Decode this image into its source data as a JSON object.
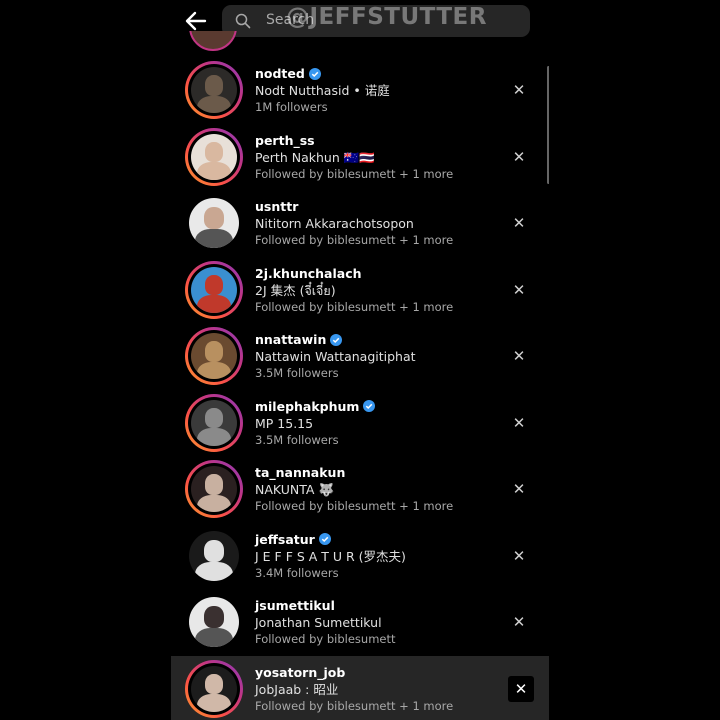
{
  "header": {
    "back_icon": "arrow-left-icon",
    "search_icon": "magnifier-icon",
    "search_placeholder": "Search",
    "watermark": "@JEFFSTUTTER"
  },
  "colors": {
    "background": "#000000",
    "search_bg": "#262626",
    "verified": "#3897f0",
    "secondary_text": "#a8a8a8",
    "story_ring": [
      "#f9a12e",
      "#fc5245",
      "#c13584",
      "#8a3ab9"
    ]
  },
  "accounts": [
    {
      "username": "nodted",
      "verified": true,
      "name": "Nodt Nutthasid • 诺庭",
      "meta": "1M followers",
      "ring": true,
      "photo": [
        "#6b5a4a",
        "#2c2a28"
      ]
    },
    {
      "username": "perth_ss",
      "verified": false,
      "name": "Perth Nakhun 🇦🇺🇹🇭",
      "meta": "Followed by biblesumett + 1 more",
      "ring": true,
      "photo": [
        "#d9b8a0",
        "#e8e0d8"
      ]
    },
    {
      "username": "usnttr",
      "verified": false,
      "name": "Nititorn Akkarachotsopon",
      "meta": "Followed by biblesumett + 1 more",
      "ring": false,
      "photo": [
        "#c9a792",
        "#e9e9e9"
      ]
    },
    {
      "username": "2j.khunchalach",
      "verified": false,
      "name": "2J 集杰 (จี๋เจี๋ย)",
      "meta": "Followed by biblesumett + 1 more",
      "ring": true,
      "photo": [
        "#c0392b",
        "#3a8fd0"
      ]
    },
    {
      "username": "nnattawin",
      "verified": true,
      "name": "Nattawin Wattanagitiphat",
      "meta": "3.5M followers",
      "ring": true,
      "photo": [
        "#b89060",
        "#6a4a30"
      ]
    },
    {
      "username": "milephakphum",
      "verified": true,
      "name": "MP 15.15",
      "meta": "3.5M followers",
      "ring": true,
      "photo": [
        "#8a8a8a",
        "#3a3a3a"
      ]
    },
    {
      "username": "ta_nannakun",
      "verified": false,
      "name": "NAKUNTA 🐺",
      "meta": "Followed by biblesumett + 1 more",
      "ring": true,
      "photo": [
        "#c8b0a0",
        "#2a2020"
      ]
    },
    {
      "username": "jeffsatur",
      "verified": true,
      "name": "J E F F  S A T U R (罗杰夫)",
      "meta": "3.4M followers",
      "ring": false,
      "photo": [
        "#e0e0e0",
        "#1a1a1a"
      ]
    },
    {
      "username": "jsumettikul",
      "verified": false,
      "name": "Jonathan Sumettikul",
      "meta": "Followed by biblesumett",
      "ring": false,
      "photo": [
        "#3a3030",
        "#e8e8e8"
      ]
    },
    {
      "username": "yosatorn_job",
      "verified": false,
      "name": "JobJaab : 昭业",
      "meta": "Followed by biblesumett + 1 more",
      "ring": true,
      "photo": [
        "#d0b8a8",
        "#1c1c1c"
      ]
    }
  ],
  "remove_label": "✕",
  "selected_index": 9
}
